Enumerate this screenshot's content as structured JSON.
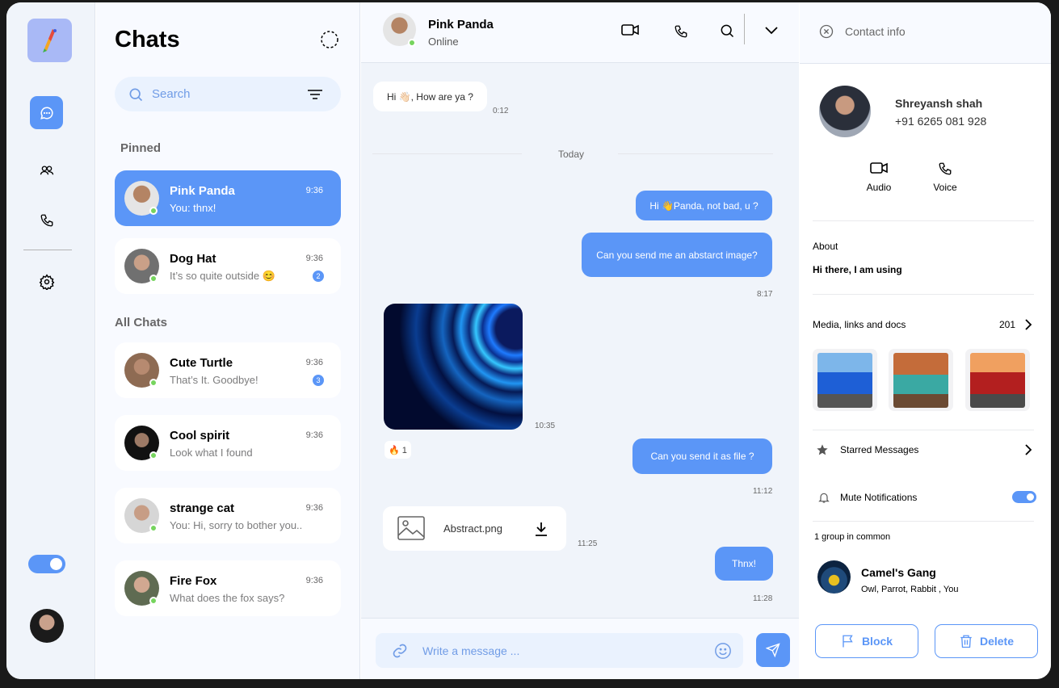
{
  "sidebar": {
    "nav_items": [
      "chat-icon",
      "users-icon",
      "phone-icon",
      "gear-icon"
    ],
    "theme_toggle_on": true
  },
  "chats": {
    "title": "Chats",
    "search_placeholder": "Search",
    "pinned_label": "Pinned",
    "all_label": "All Chats",
    "pinned": [
      {
        "name": "Pink Panda",
        "time": "9:36",
        "preview": "You: thnx!",
        "badge": ""
      },
      {
        "name": "Dog Hat",
        "time": "9:36",
        "preview": "It’s so quite outside 😊",
        "badge": "2"
      }
    ],
    "all": [
      {
        "name": "Cute Turtle",
        "time": "9:36",
        "preview": "That’s It. Goodbye!",
        "badge": "3"
      },
      {
        "name": "Cool spirit",
        "time": "9:36",
        "preview": "Look what I found",
        "badge": ""
      },
      {
        "name": "strange cat",
        "time": "9:36",
        "preview": "You: Hi, sorry to bother you..",
        "badge": ""
      },
      {
        "name": "Fire Fox",
        "time": "9:36",
        "preview": "What does the fox says?",
        "badge": ""
      }
    ]
  },
  "conversation": {
    "name": "Pink Panda",
    "status": "Online",
    "divider": "Today",
    "messages": [
      {
        "text": "Hi 👋🏻, How are ya ?",
        "time": "0:12"
      },
      {
        "text": "Hi 👋Panda, not bad, u ?",
        "time": ""
      },
      {
        "text": "Can you send me an abstarct image?",
        "time": "8:17"
      },
      {
        "text": "",
        "time": "10:35"
      },
      {
        "text": "Can you send it as file ?",
        "time": "11:12"
      },
      {
        "text": "Thnx!",
        "time": "11:28"
      }
    ],
    "reaction": "🔥 1",
    "file_name": "Abstract.png",
    "file_time": "11:25",
    "input_placeholder": "Write a message ..."
  },
  "contact": {
    "header": "Contact info",
    "name": "Shreyansh shah",
    "phone": "+91 6265 081 928",
    "audio_label": "Audio",
    "voice_label": "Voice",
    "about_label": "About",
    "about_text": "Hi there, I am using",
    "media_label": "Media, links and docs",
    "media_count": "201",
    "starred_label": "Starred Messages",
    "mute_label": "Mute Notifications",
    "mute_on": true,
    "groups_label": "1 group in common",
    "group_name": "Camel's Gang",
    "group_members": "Owl, Parrot, Rabbit , You",
    "block_label": "Block",
    "delete_label": "Delete"
  }
}
